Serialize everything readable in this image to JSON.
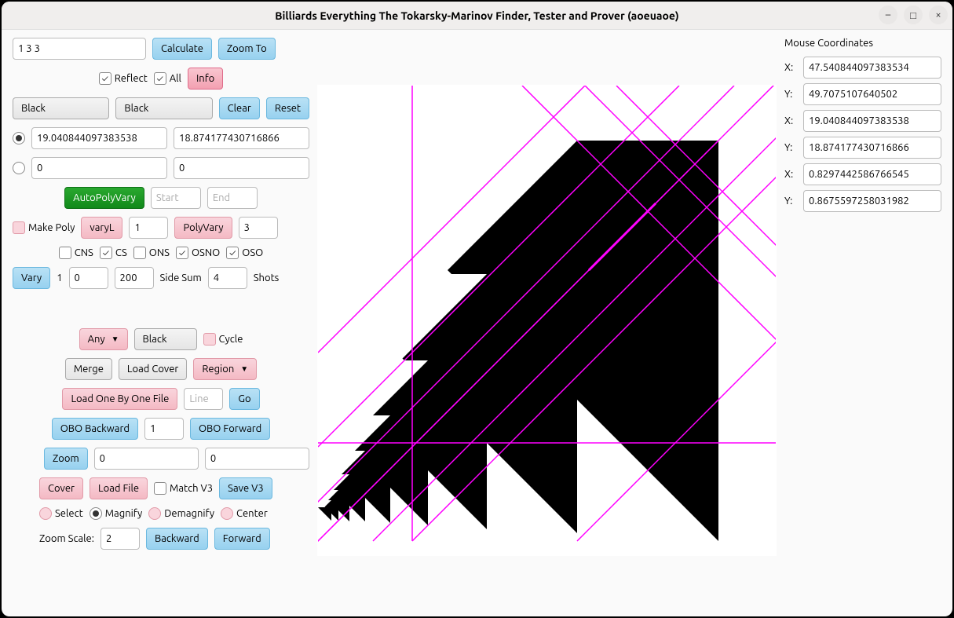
{
  "title": "Billiards Everything The Tokarsky-Marinov Finder, Tester and Prover (aoeuaoe)",
  "top_input": "1 3 3",
  "calculate": "Calculate",
  "zoom_to": "Zoom To",
  "reflect": "Reflect",
  "all": "All",
  "info": "Info",
  "black1": "Black",
  "black2": "Black",
  "clear": "Clear",
  "reset": "Reset",
  "coord1": "19.040844097383538",
  "coord2": "18.874177430716866",
  "zero": "0",
  "autopolyvary": "AutoPolyVary",
  "start_ph": "Start",
  "end_ph": "End",
  "makepoly": "Make Poly",
  "varyl": "varyL",
  "varyl_n": "1",
  "polyvary": "PolyVary",
  "polyvary_n": "3",
  "cns": "CNS",
  "cs": "CS",
  "ons": "ONS",
  "osno": "OSNO",
  "oso": "OSO",
  "vary": "Vary",
  "vary_1": "1",
  "vary_n1": "0",
  "vary_n2": "200",
  "side_sum": "Side Sum",
  "side_sum_n": "4",
  "shots": "Shots",
  "any": "Any",
  "black3": "Black",
  "cycle": "Cycle",
  "merge": "Merge",
  "load_cover": "Load Cover",
  "region": "Region",
  "load_obo_file": "Load One By One File",
  "line_ph": "Line",
  "go": "Go",
  "obo_back": "OBO Backward",
  "obo_n": "1",
  "obo_fwd": "OBO Forward",
  "zoom": "Zoom",
  "zoom_n1": "0",
  "zoom_n2": "0",
  "cover": "Cover",
  "load_file": "Load File",
  "match_v3": "Match V3",
  "save_v3": "Save V3",
  "select": "Select",
  "magnify": "Magnify",
  "demagnify": "Demagnify",
  "center_l": "Center",
  "zoom_scale": "Zoom Scale:",
  "zoom_scale_n": "2",
  "backward": "Backward",
  "forward": "Forward",
  "mouse_title": "Mouse Coordinates",
  "mx1_l": "X:",
  "mx1": "47.540844097383534",
  "my1_l": "Y:",
  "my1": "49.7075107640502",
  "mx2_l": "X:",
  "mx2": "19.040844097383538",
  "my2_l": "Y:",
  "my2": "18.874177430716866",
  "mx3_l": "X:",
  "mx3": "0.8297442586766545",
  "my3_l": "Y:",
  "my3": "0.8675597258031982"
}
